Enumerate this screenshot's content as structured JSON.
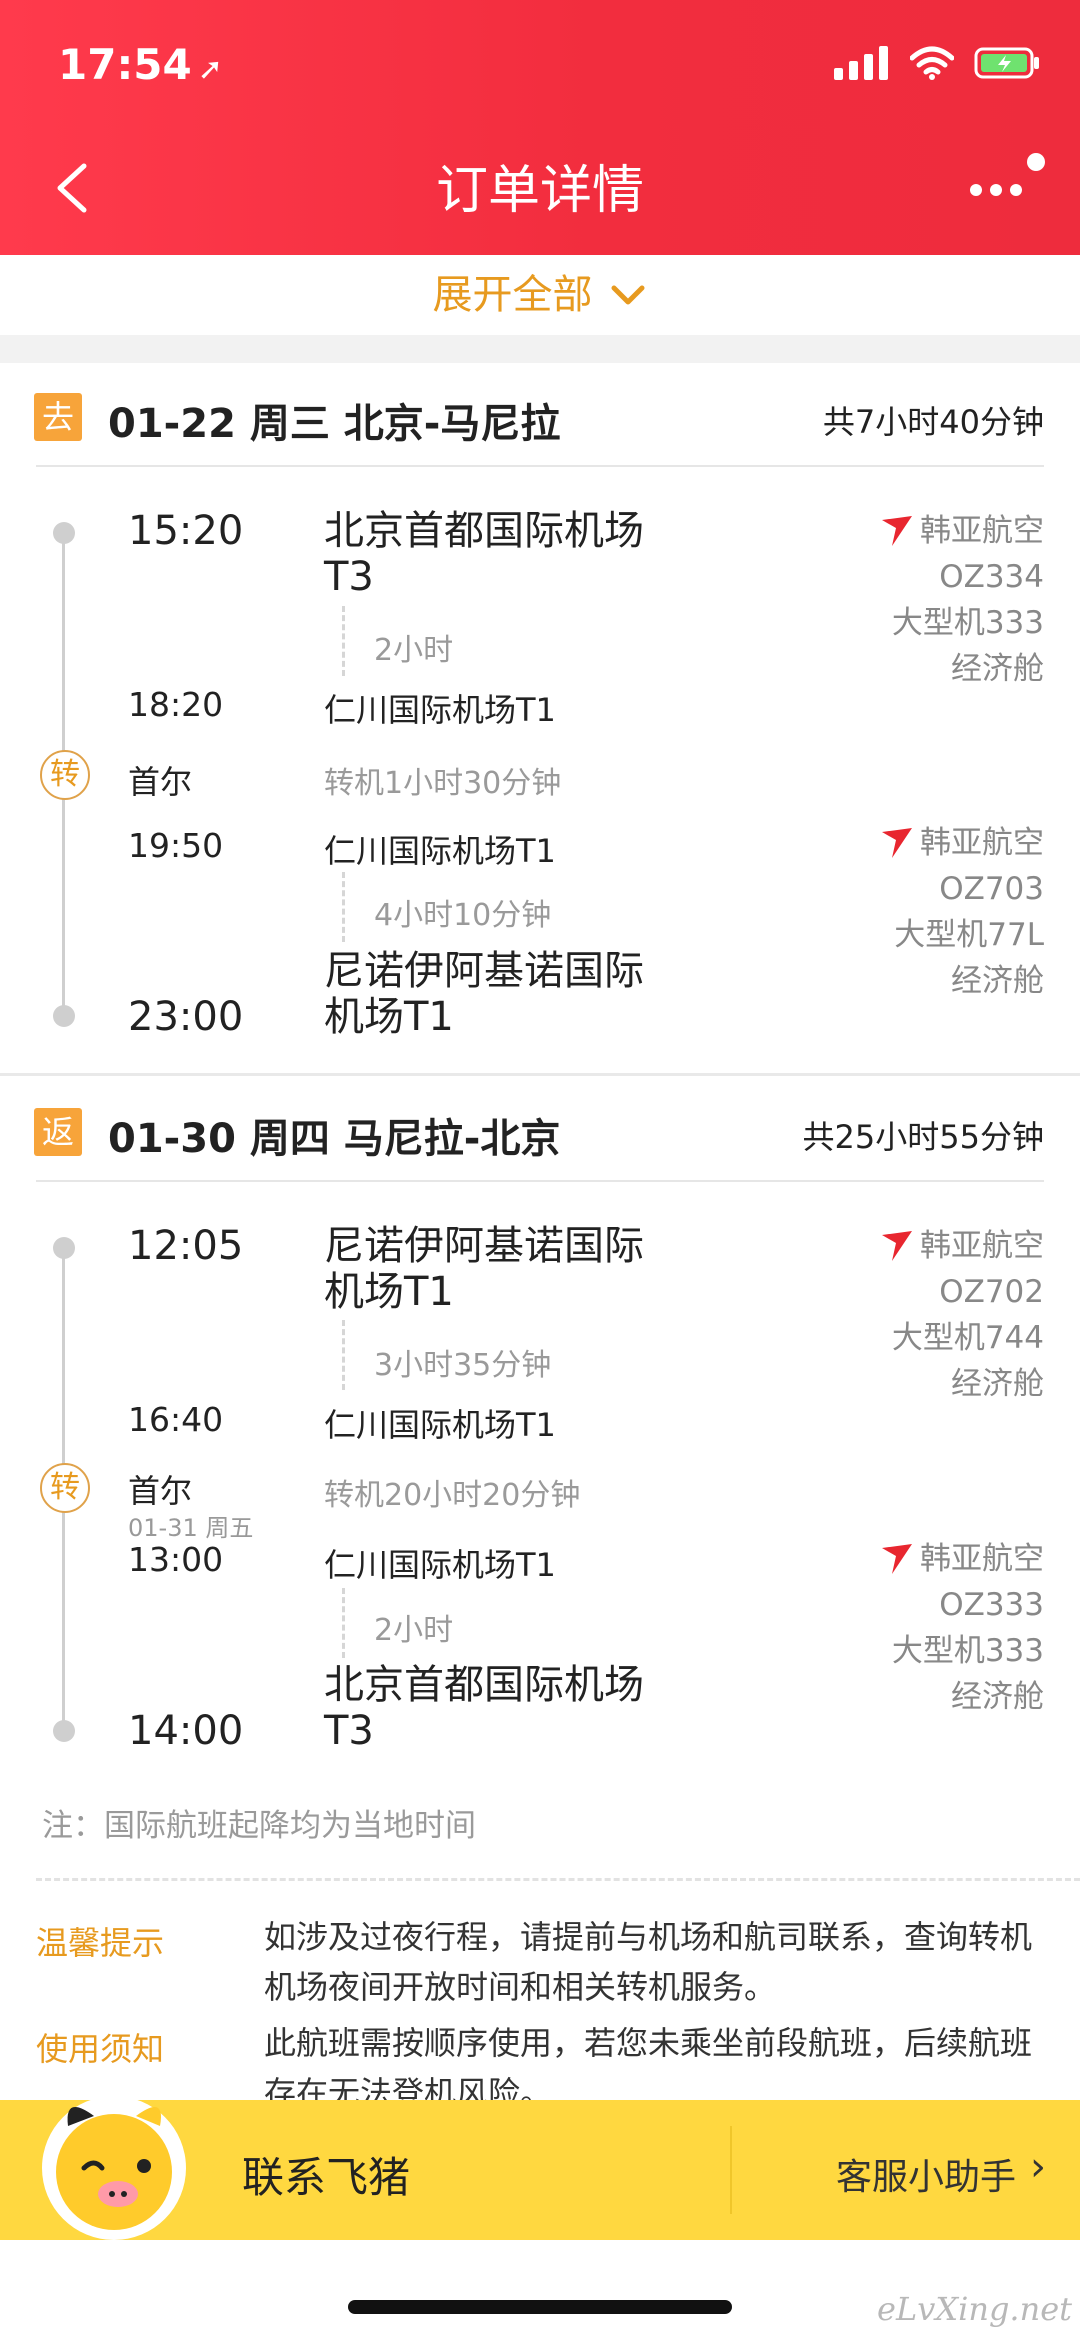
{
  "status_bar": {
    "time": "17:54"
  },
  "nav": {
    "title": "订单详情"
  },
  "expand": {
    "label": "展开全部"
  },
  "outbound": {
    "tag": "去",
    "title": "01-22 周三 北京-马尼拉",
    "total": "共7小时40分钟",
    "leg1": {
      "dep_time": "15:20",
      "dep_airport_l1": "北京首都国际机场",
      "dep_airport_l2": "T3",
      "duration": "2小时",
      "arr_time": "18:20",
      "arr_airport": "仁川国际机场T1",
      "airline": "韩亚航空",
      "flight_no": "OZ334",
      "aircraft": "大型机333",
      "cabin": "经济舱"
    },
    "transfer": {
      "badge": "转",
      "city": "首尔",
      "layover": "转机1小时30分钟"
    },
    "leg2": {
      "dep_time": "19:50",
      "dep_airport": "仁川国际机场T1",
      "duration": "4小时10分钟",
      "arr_time": "23:00",
      "arr_airport_l1": "尼诺伊阿基诺国际",
      "arr_airport_l2": "机场T1",
      "airline": "韩亚航空",
      "flight_no": "OZ703",
      "aircraft": "大型机77L",
      "cabin": "经济舱"
    }
  },
  "return": {
    "tag": "返",
    "title": "01-30 周四 马尼拉-北京",
    "total": "共25小时55分钟",
    "leg1": {
      "dep_time": "12:05",
      "dep_airport_l1": "尼诺伊阿基诺国际",
      "dep_airport_l2": "机场T1",
      "duration": "3小时35分钟",
      "arr_time": "16:40",
      "arr_airport": "仁川国际机场T1",
      "airline": "韩亚航空",
      "flight_no": "OZ702",
      "aircraft": "大型机744",
      "cabin": "经济舱"
    },
    "transfer": {
      "badge": "转",
      "city": "首尔",
      "date": "01-31 周五",
      "layover": "转机20小时20分钟"
    },
    "leg2": {
      "dep_time": "13:00",
      "dep_airport": "仁川国际机场T1",
      "duration": "2小时",
      "arr_time": "14:00",
      "arr_airport_l1": "北京首都国际机场",
      "arr_airport_l2": "T3",
      "airline": "韩亚航空",
      "flight_no": "OZ333",
      "aircraft": "大型机333",
      "cabin": "经济舱"
    }
  },
  "note": "注：国际航班起降均为当地时间",
  "tips": [
    {
      "label": "温馨提示",
      "text": "如涉及过夜行程，请提前与机场和航司联系，查询转机机场夜间开放时间和相关转机服务。"
    },
    {
      "label": "使用须知",
      "text": "此航班需按顺序使用，若您未乘坐前段航班，后续航班存在无法登机风险。"
    }
  ],
  "contact": {
    "title": "联系飞猪",
    "assistant": "客服小助手"
  },
  "watermark": "eLvXing.net",
  "colors": {
    "header_red": "#f22d3e",
    "accent_orange": "#e79a1f",
    "contact_yellow": "#ffd840"
  }
}
